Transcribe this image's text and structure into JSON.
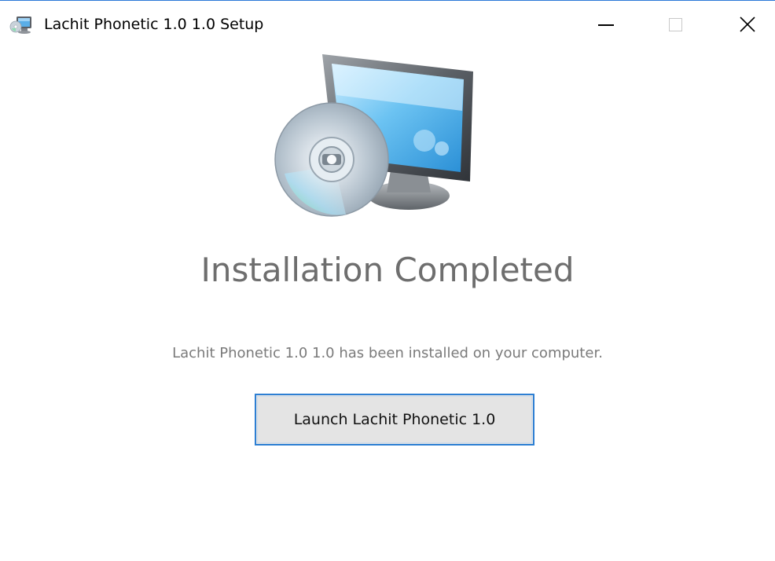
{
  "window": {
    "title": "Lachit Phonetic 1.0 1.0 Setup",
    "app_icon": "installer-icon",
    "controls": {
      "minimize": "minimize-icon",
      "maximize": "maximize-icon",
      "close": "close-icon"
    },
    "accent_color": "#2d7fd3"
  },
  "main": {
    "hero_image": "installer-computer-disc-icon",
    "heading": "Installation Completed",
    "message": "Lachit Phonetic 1.0 1.0 has been installed on your computer.",
    "launch_button_label": "Launch Lachit Phonetic 1.0"
  }
}
